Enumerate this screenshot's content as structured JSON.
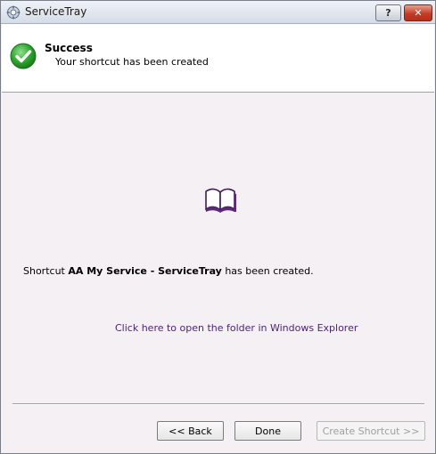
{
  "window": {
    "title": "ServiceTray",
    "help_label": "?",
    "close_label": "✕"
  },
  "header": {
    "title": "Success",
    "subtitle": "Your shortcut has been created"
  },
  "content": {
    "message_prefix": "Shortcut ",
    "shortcut_name": "AA My Service - ServiceTray",
    "message_suffix": " has been created.",
    "folder_link": "Click here to open the folder in Windows Explorer"
  },
  "buttons": {
    "back_label": "<< Back",
    "done_label": "Done",
    "create_label": "Create Shortcut >>"
  },
  "colors": {
    "link": "#4a2472",
    "success": "#2c9e2c",
    "book": "#5a2a78"
  },
  "icons": {
    "app": "servicetray-gear-icon",
    "success": "checkmark-circle-icon",
    "book": "book-icon"
  }
}
